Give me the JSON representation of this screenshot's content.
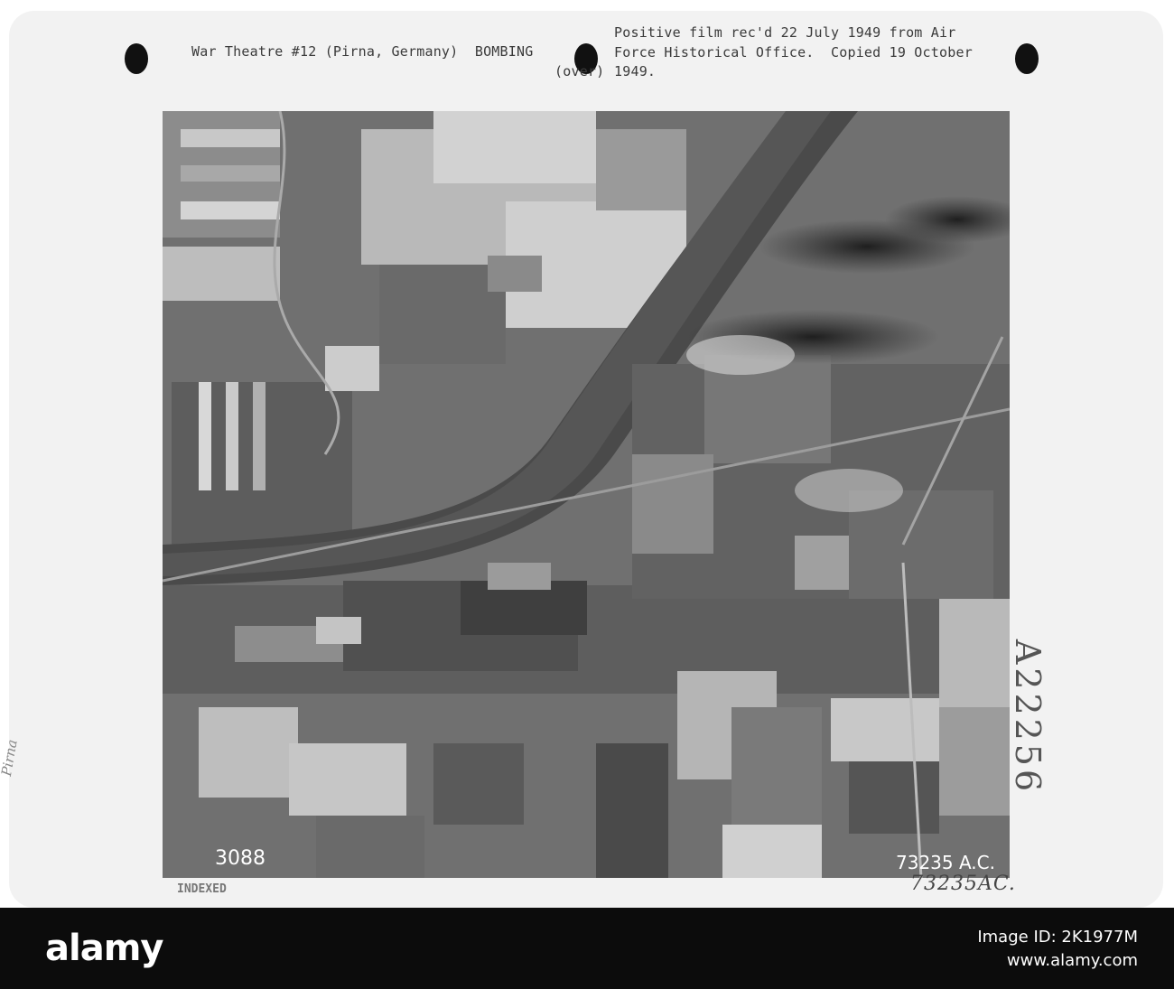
{
  "caption": {
    "left": "War Theatre #12 (Pirna, Germany)  BOMBING",
    "over": "(over)",
    "right_line1": "Positive film rec'd 22 July 1949 from Air",
    "right_line2": "Force Historical Office.  Copied 19 October",
    "right_line3": "1949."
  },
  "photo": {
    "frame_number": "3088",
    "negative_number": "73235 A.C."
  },
  "stamp": "INDEXED",
  "handwritten_number": "73235AC.",
  "vertical_id": "A22256",
  "pencil_note": "Pirna",
  "footer": {
    "brand": "alamy",
    "image_id_label": "Image ID: 2K1977M",
    "url": "www.alamy.com"
  },
  "colors": {
    "card": "#f2f2f2",
    "footer": "#0c0c0c"
  }
}
